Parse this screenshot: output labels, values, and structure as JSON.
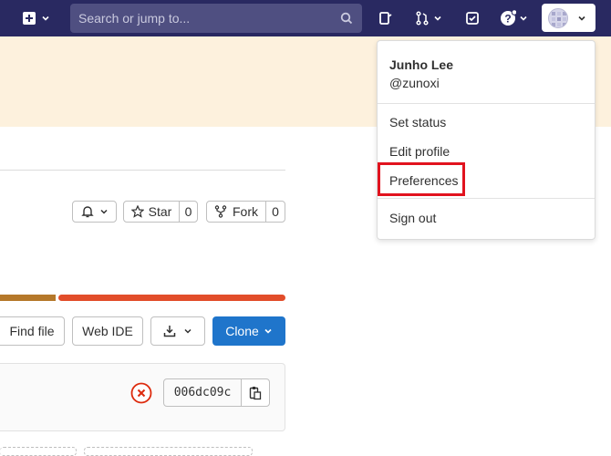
{
  "topbar": {
    "search_placeholder": "Search or jump to..."
  },
  "project": {
    "star_label": "Star",
    "star_count": "0",
    "fork_label": "Fork",
    "fork_count": "0",
    "find_file_label": "Find file",
    "web_ide_label": "Web IDE",
    "clone_label": "Clone"
  },
  "commit": {
    "sha": "006dc09c"
  },
  "user_menu": {
    "name": "Junho Lee",
    "username": "@zunoxi",
    "items": [
      "Set status",
      "Edit profile",
      "Preferences",
      "Sign out"
    ]
  },
  "colors": {
    "topbar": "#292961",
    "banner": "#fdf1dd",
    "clone": "#1f75cb",
    "highlight": "#e1131e"
  }
}
